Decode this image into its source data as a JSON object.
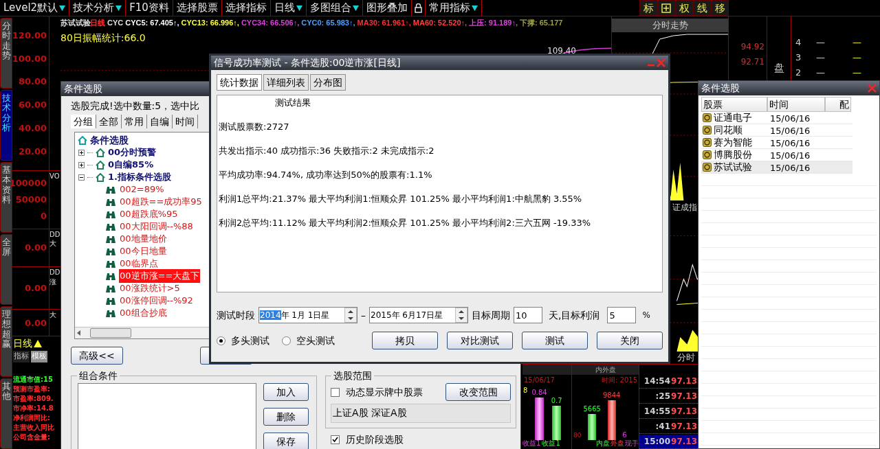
{
  "menu_bar": {
    "items": [
      {
        "kind": "menu",
        "label": "Level2默认",
        "dropdown": true
      },
      {
        "kind": "menu",
        "label": "技术分析",
        "dropdown": true
      },
      {
        "kind": "menu",
        "label": "F10资料",
        "dropdown": false
      },
      {
        "kind": "menu",
        "label": "选择股票",
        "dropdown": false
      },
      {
        "kind": "menu",
        "label": "选择指标",
        "dropdown": false
      },
      {
        "kind": "menu",
        "label": "日线",
        "dropdown": true
      },
      {
        "kind": "menu",
        "label": "多图组合",
        "dropdown": true
      },
      {
        "kind": "menu",
        "label": "图形叠加",
        "dropdown": false
      },
      {
        "kind": "lock"
      },
      {
        "kind": "menu",
        "label": "常用指标",
        "dropdown": true
      }
    ],
    "tool_buttons": [
      {
        "kind": "text",
        "label": "标"
      },
      {
        "kind": "icon"
      },
      {
        "kind": "text",
        "label": "权"
      },
      {
        "kind": "text",
        "label": "线"
      },
      {
        "kind": "text",
        "label": "移"
      }
    ]
  },
  "side_tabs": [
    {
      "label": "分时走势",
      "selected": false
    },
    {
      "label": "技术分析",
      "selected": true
    },
    {
      "label": "基本资料",
      "selected": false
    },
    {
      "label": "全屏",
      "selected": false
    },
    {
      "label": "理想超赢",
      "selected": false
    },
    {
      "label": "其他",
      "selected": false
    }
  ],
  "axis_panes": [
    {
      "labels": [
        "120.00",
        "100.00",
        "80.00",
        "60.00",
        "40.00",
        "20.00"
      ]
    },
    {
      "labels": [
        "100000",
        "50000",
        "0"
      ],
      "tags": [
        "VO"
      ]
    },
    {
      "labels": [
        "0.00"
      ],
      "tags": [
        "DD",
        "大"
      ]
    },
    {
      "labels": [
        "0.00"
      ],
      "tags": [
        "DD",
        "涨"
      ]
    },
    {
      "labels": [
        "0.00"
      ],
      "tags": [
        "大"
      ]
    }
  ],
  "period_bar": {
    "period": "日线",
    "tabs": [
      {
        "label": "指标",
        "selected": false
      },
      {
        "label": "模板",
        "selected": true
      }
    ]
  },
  "stats": [
    {
      "text": "流通市值:15",
      "color": "#33ff33"
    },
    {
      "text": "预测市盈率:",
      "color": "#ff3030"
    },
    {
      "text": "市盈率:809.",
      "color": "#ff3030"
    },
    {
      "text": "市净率:14.8",
      "color": "#ff3030"
    },
    {
      "text": "净利润同比:",
      "color": "#ff3030"
    },
    {
      "text": "主营收入同比",
      "color": "#ff3030"
    },
    {
      "text": "公司含金量:",
      "color": "#ff3030"
    }
  ],
  "chart": {
    "stock": "苏试试验",
    "period": "日线",
    "indicators": [
      {
        "text": "CYC",
        "color": "#e0e0e0"
      },
      {
        "text": "CYC5: 67.405↑,",
        "color": "#ffffff"
      },
      {
        "text": "CYC13: 66.996↑,",
        "color": "#ffff40"
      },
      {
        "text": "CYC34: 66.506↑,",
        "color": "#e040e0"
      },
      {
        "text": "CYC0: 65.983↑,",
        "color": "#4aa0ff"
      },
      {
        "text": "MA30: 61.961↑,",
        "color": "#ff3030"
      },
      {
        "text": "MA60: 52.520↑,",
        "color": "#ff4040"
      },
      {
        "text": "上压: 91.189↑,",
        "color": "#e040e0"
      },
      {
        "text": "下撑: 65.177",
        "color": "#a0a040"
      }
    ],
    "amplitude": "80日振幅统计:66.0",
    "peak_label": "109.40"
  },
  "intraday": {
    "title": "分时走势",
    "prices": [
      "94.92",
      "92.71"
    ],
    "book_side": "盘",
    "book_rows": [
      {
        "rank": "4",
        "column_2": "—",
        "column_3": "—"
      },
      {
        "rank": "3",
        "column_2": "—",
        "column_3": "—"
      },
      {
        "rank": "2",
        "column_2": "—",
        "column_3": "—"
      }
    ],
    "index_label": "证成指",
    "footer": "分时"
  },
  "mini_panels": {
    "date": "15/06/17",
    "side_mark": "8",
    "gain_a": "0.84",
    "gain_b": "0.7",
    "gain_labels": [
      "收益1",
      "收益1"
    ],
    "volume_title": "内外盘",
    "time_label": "时间: 2015",
    "outer_value": "9844",
    "inner_value": "5665",
    "hand_value": "6",
    "base_value": "80",
    "volume_labels": [
      "内盘",
      "外盘",
      "现手"
    ],
    "ticks": [
      {
        "time": "14:54",
        "price": "97.13",
        "selected": false
      },
      {
        "time": ":25",
        "price": "97.13",
        "selected": false
      },
      {
        "time": "14:55",
        "price": "97.13",
        "selected": false
      },
      {
        "time": ":41",
        "price": "97.13",
        "selected": false
      },
      {
        "time": "15:00",
        "price": "97.13",
        "selected": true
      }
    ]
  },
  "selector_dialog": {
    "title": "条件选股",
    "status": "选股完成!选中数量:5，选中比",
    "tabs": [
      {
        "label": "分组",
        "selected": true
      },
      {
        "label": "全部",
        "selected": false
      },
      {
        "label": "常用",
        "selected": false
      },
      {
        "label": "自编",
        "selected": false
      },
      {
        "label": "时间",
        "selected": false
      }
    ],
    "tree": {
      "kind": "root",
      "label": "条件选股",
      "children": [
        {
          "kind": "folder",
          "label": "00分时预警",
          "expanded": false
        },
        {
          "kind": "folder",
          "label": "0自编85%",
          "expanded": false
        },
        {
          "kind": "folder",
          "label": "1.指标条件选股",
          "expanded": true,
          "children": [
            {
              "kind": "item",
              "label": "002=89%",
              "selected": false
            },
            {
              "kind": "item",
              "label": "00超跌==成功率95",
              "selected": false
            },
            {
              "kind": "item",
              "label": "00超跌底%95",
              "selected": false
            },
            {
              "kind": "item",
              "label": "00大阳回调--%88",
              "selected": false
            },
            {
              "kind": "item",
              "label": "00地量地价",
              "selected": false
            },
            {
              "kind": "item",
              "label": "00今日地量",
              "selected": false
            },
            {
              "kind": "item",
              "label": "00临界点",
              "selected": false
            },
            {
              "kind": "item",
              "label": "00逆市涨==大盘下",
              "selected": true
            },
            {
              "kind": "item",
              "label": "00涨跌统计>5",
              "selected": false
            },
            {
              "kind": "item",
              "label": "00涨停回调--%92",
              "selected": false
            },
            {
              "kind": "item",
              "label": "00组合抄底",
              "selected": false
            }
          ]
        }
      ]
    },
    "advanced_button": "高级<<",
    "combo_group": {
      "title": "组合条件",
      "buttons": [
        "加入",
        "删除",
        "保存"
      ]
    },
    "range_group": {
      "title": "选股范围",
      "dynamic_check": {
        "label": "动态显示牌中股票",
        "checked": false
      },
      "change_button": "改变范围",
      "markets": "上证A股 深证A股"
    },
    "history_check": {
      "label": "历史阶段选股",
      "checked": true
    }
  },
  "test_dialog": {
    "title": "信号成功率测试 - 条件选股:00逆市涨[日线]",
    "tabs": [
      {
        "label": "统计数据",
        "selected": true
      },
      {
        "label": "详细列表",
        "selected": false
      },
      {
        "label": "分布图",
        "selected": false
      }
    ],
    "heading": "测试结果",
    "lines": [
      "测试股票数:2727",
      "共发出指示:40 成功指示:36 失败指示:2 未完成指示:2",
      "平均成功率:94.74%, 成功率达到50%的股票有:1.1%",
      "利润1总平均:21.37% 最大平均利润1:恒顺众昇 101.25% 最小平均利润1:中航黑豹 3.55%",
      "利润2总平均:11.12% 最大平均利润2:恒顺众昇 101.25% 最小平均利润2:三六五网 -19.33%"
    ],
    "period_label": "测试时段",
    "start_date": {
      "selected_part": "2014",
      "rest": "年 1月 1日星"
    },
    "date_separator": "–",
    "end_date": "2015年 6月17日星",
    "cycle_label": "目标周期",
    "cycle_value": "10",
    "profit_label": "天,目标利润",
    "profit_value": "5",
    "percent": "%",
    "modes": [
      {
        "label": "多头测试",
        "selected": true
      },
      {
        "label": "空头测试",
        "selected": false
      }
    ],
    "buttons": [
      "拷贝",
      "对比测试",
      "测试",
      "关闭"
    ]
  },
  "result_window": {
    "title": "条件选股",
    "columns": [
      "股票",
      "时间",
      "配"
    ],
    "rows": [
      {
        "stock": "证通电子",
        "time": "15/06/16",
        "selected": false
      },
      {
        "stock": "同花顺",
        "time": "15/06/16",
        "selected": false
      },
      {
        "stock": "赛为智能",
        "time": "15/06/16",
        "selected": false
      },
      {
        "stock": "博腾股份",
        "time": "15/06/16",
        "selected": false
      },
      {
        "stock": "苏试试验",
        "time": "15/06/16",
        "selected": true
      }
    ]
  }
}
